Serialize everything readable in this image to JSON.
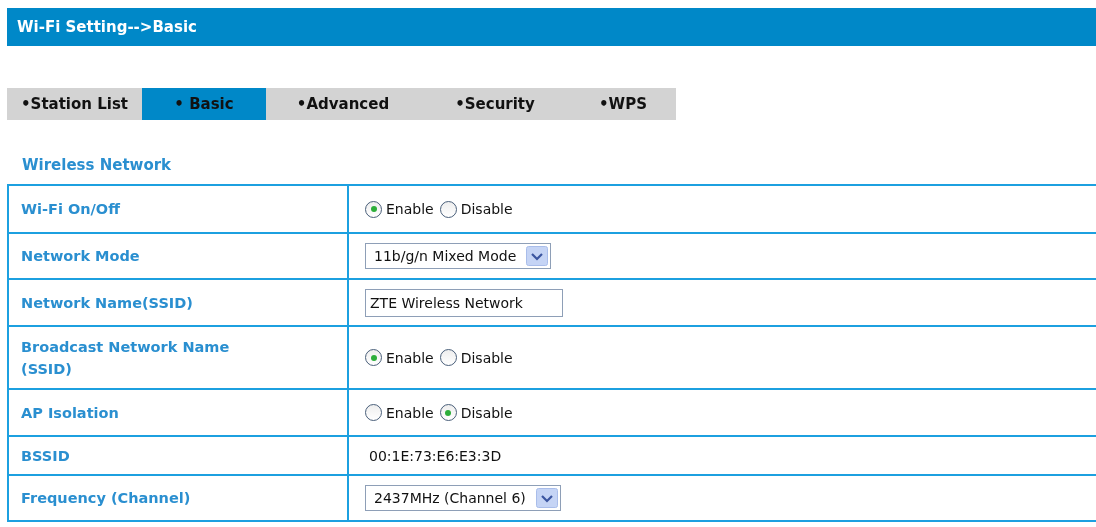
{
  "header": {
    "title": "Wi-Fi Setting-->Basic"
  },
  "tabs": [
    {
      "label": "•Station List",
      "selected": false
    },
    {
      "label": "• Basic",
      "selected": true
    },
    {
      "label": "•Advanced",
      "selected": false
    },
    {
      "label": "•Security",
      "selected": false
    },
    {
      "label": "•WPS",
      "selected": false
    }
  ],
  "section_title": "Wireless Network",
  "rows": [
    {
      "label": "Wi-Fi On/Off",
      "kind": "radio",
      "options": [
        {
          "label": "Enable",
          "selected": true
        },
        {
          "label": "Disable",
          "selected": false
        }
      ]
    },
    {
      "label": "Network Mode",
      "kind": "select",
      "value": "11b/g/n Mixed Mode"
    },
    {
      "label": "Network Name(SSID)",
      "kind": "text",
      "value": "ZTE Wireless Network"
    },
    {
      "label": "Broadcast Network Name (SSID)",
      "kind": "radio",
      "options": [
        {
          "label": "Enable",
          "selected": true
        },
        {
          "label": "Disable",
          "selected": false
        }
      ]
    },
    {
      "label": "AP Isolation",
      "kind": "radio",
      "options": [
        {
          "label": "Enable",
          "selected": false
        },
        {
          "label": "Disable",
          "selected": true
        }
      ]
    },
    {
      "label": "BSSID",
      "kind": "static",
      "value": "00:1E:73:E6:E3:3D"
    },
    {
      "label": "Frequency (Channel)",
      "kind": "select",
      "value": "2437MHz (Channel 6)"
    }
  ]
}
